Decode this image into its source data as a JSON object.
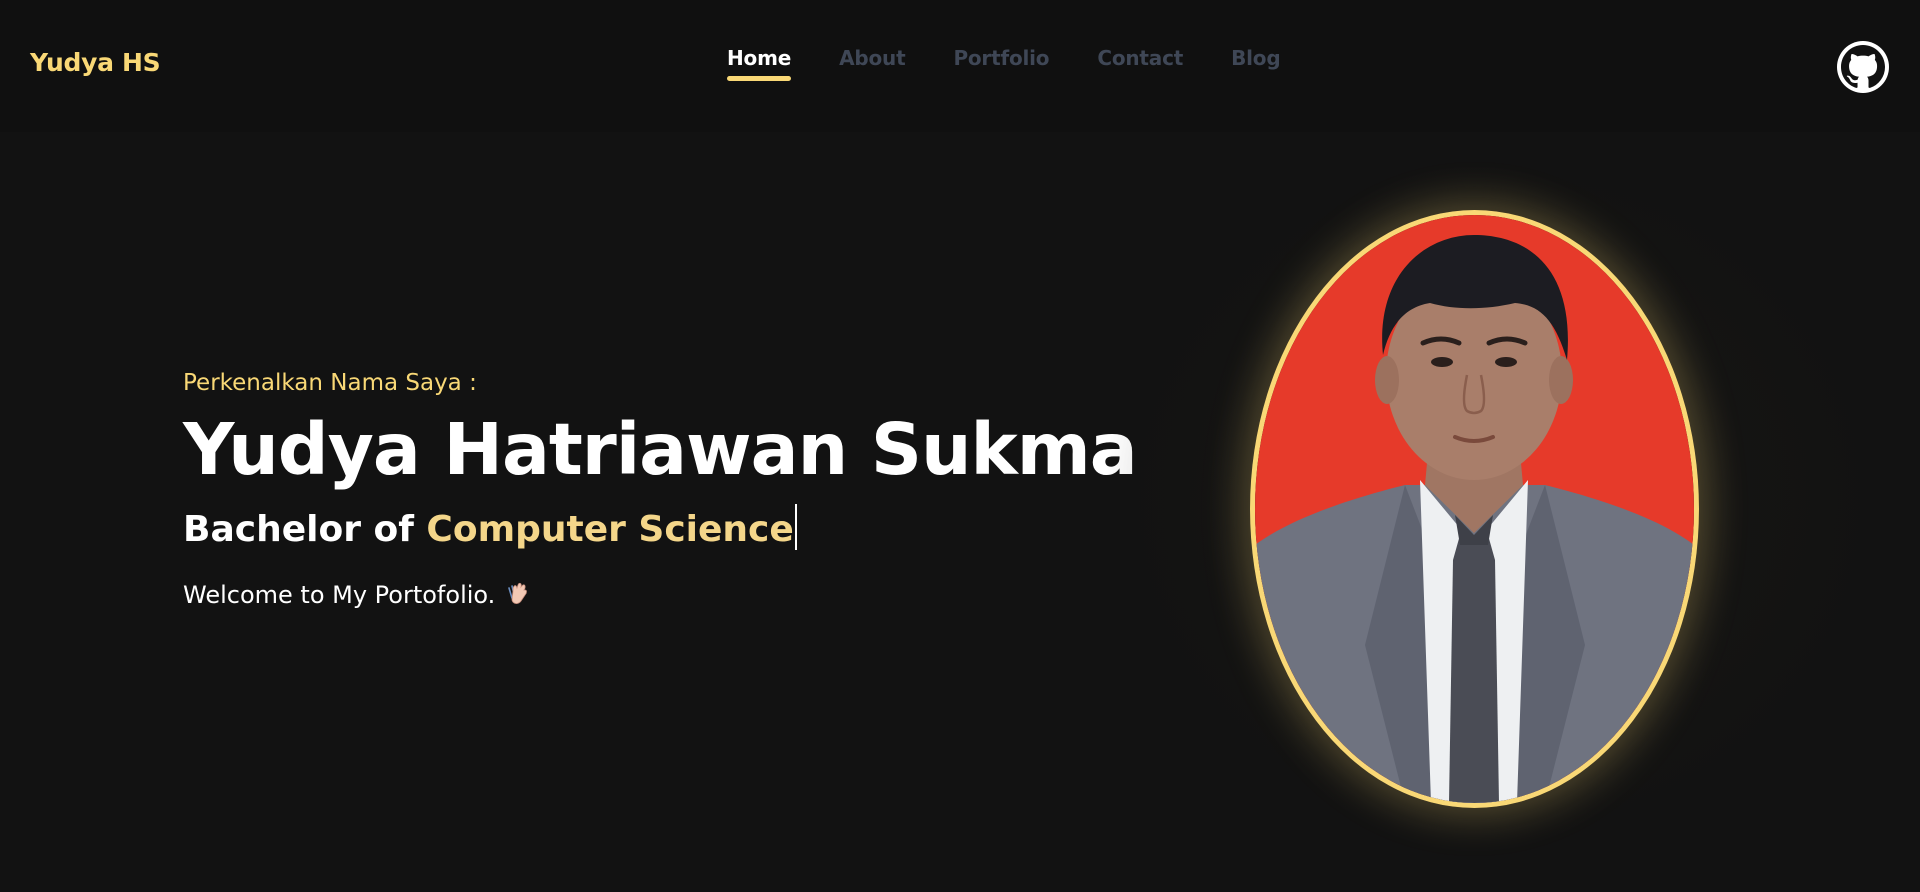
{
  "brand": "Yudya HS",
  "nav": {
    "links": [
      "Home",
      "About",
      "Portfolio",
      "Contact",
      "Blog"
    ],
    "active": "Home"
  },
  "hero": {
    "intro": "Perkenalkan Nama Saya :",
    "name": "Yudya Hatriawan Sukma",
    "degree_prefix": "Bachelor of",
    "degree_accent": "Computer Science",
    "welcome": "Welcome to My Portofolio."
  },
  "icons": {
    "github": "github-icon",
    "wave": "waving-hand-icon"
  },
  "colors": {
    "background": "#121212",
    "accent": "#f9d876",
    "nav_inactive": "#3f4756",
    "portrait_background": "#e63a2a"
  }
}
